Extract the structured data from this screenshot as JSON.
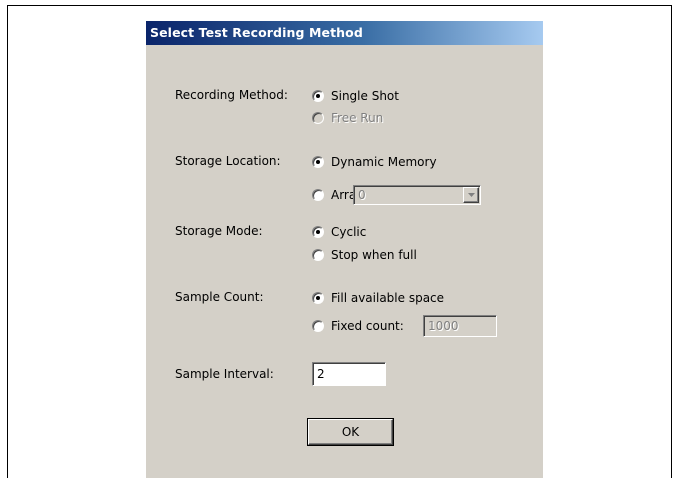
{
  "dialog": {
    "title": "Select Test Recording Method",
    "recording_method": {
      "label": "Recording Method:",
      "options": [
        {
          "label": "Single Shot",
          "checked": true,
          "enabled": true
        },
        {
          "label": "Free Run",
          "checked": false,
          "enabled": false
        }
      ]
    },
    "storage_location": {
      "label": "Storage Location:",
      "options": [
        {
          "label": "Dynamic Memory",
          "checked": true,
          "enabled": true
        },
        {
          "label": "Array:",
          "checked": false,
          "enabled": true
        }
      ],
      "array_value": "0"
    },
    "storage_mode": {
      "label": "Storage Mode:",
      "options": [
        {
          "label": "Cyclic",
          "checked": true,
          "enabled": true
        },
        {
          "label": "Stop when full",
          "checked": false,
          "enabled": true
        }
      ]
    },
    "sample_count": {
      "label": "Sample Count:",
      "options": [
        {
          "label": "Fill available space",
          "checked": true,
          "enabled": true
        },
        {
          "label": "Fixed count:",
          "checked": false,
          "enabled": true
        }
      ],
      "fixed_count_value": "1000"
    },
    "sample_interval": {
      "label": "Sample Interval:",
      "value": "2"
    },
    "ok_label": "OK"
  },
  "colors": {
    "dialog_bg": "#d4d0c8",
    "titlebar_start": "#0a246a",
    "titlebar_end": "#a6caf0",
    "disabled_text": "#808080"
  }
}
